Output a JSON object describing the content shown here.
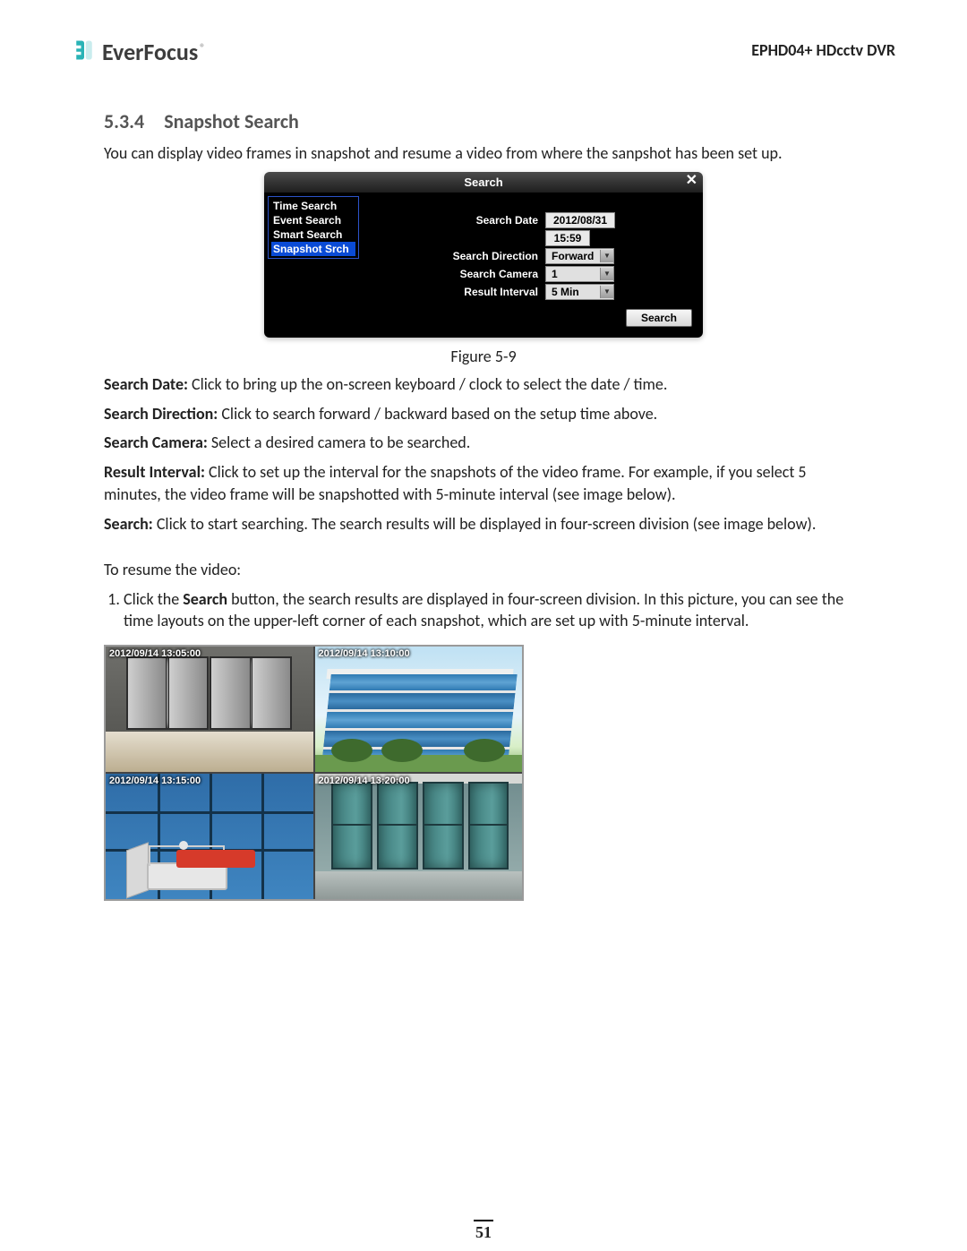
{
  "brand": {
    "name": "EverFocus",
    "registered": "®"
  },
  "doc_title": "EPHD04+  HDcctv DVR",
  "section": {
    "number": "5.3.4",
    "title": "Snapshot Search"
  },
  "intro": "You can display video frames in snapshot and resume a video from where the sanpshot has been set up.",
  "dialog": {
    "title": "Search",
    "close": "✕",
    "sidebar": {
      "items": [
        "Time Search",
        "Event Search",
        "Smart Search",
        "Snapshot Srch"
      ],
      "selected_index": 3
    },
    "fields": {
      "search_date_label": "Search Date",
      "search_date_value": "2012/08/31",
      "search_time_value": "15:59",
      "direction_label": "Search Direction",
      "direction_value": "Forward",
      "camera_label": "Search Camera",
      "camera_value": "1",
      "interval_label": "Result Interval",
      "interval_value": "5 Min"
    },
    "search_button": "Search"
  },
  "figure_caption": "Figure 5-9",
  "definitions": {
    "search_date": {
      "term": "Search Date:",
      "text": " Click to bring up the on-screen keyboard / clock to select the date / time."
    },
    "search_direction": {
      "term": "Search Direction:",
      "text": " Click to search forward / backward based on the setup time above."
    },
    "search_camera": {
      "term": "Search Camera:",
      "text": " Select a desired camera to be searched."
    },
    "result_interval": {
      "term": "Result Interval:",
      "text": " Click to set up the interval for the snapshots of the video frame. For example, if you select 5 minutes, the video frame will be snapshotted with 5-minute interval (see image below)."
    },
    "search": {
      "term": "Search:",
      "text": " Click to start searching. The search results will be displayed in four-screen division (see image below)."
    }
  },
  "resume_intro": "To resume the video:",
  "resume_step1": {
    "prefix": "Click the ",
    "bold": "Search",
    "suffix": " button, the search results are displayed in four-screen division. In this picture, you can see the time layouts on the upper-left corner of each snapshot, which are set up with 5-minute interval."
  },
  "snapshots": {
    "ts1": "2012/09/14  13:05:00",
    "ts2": "2012/09/14  13:10:00",
    "ts3": "2012/09/14  13:15:00",
    "ts4": "2012/09/14  13:20:00"
  },
  "page_number": "51"
}
